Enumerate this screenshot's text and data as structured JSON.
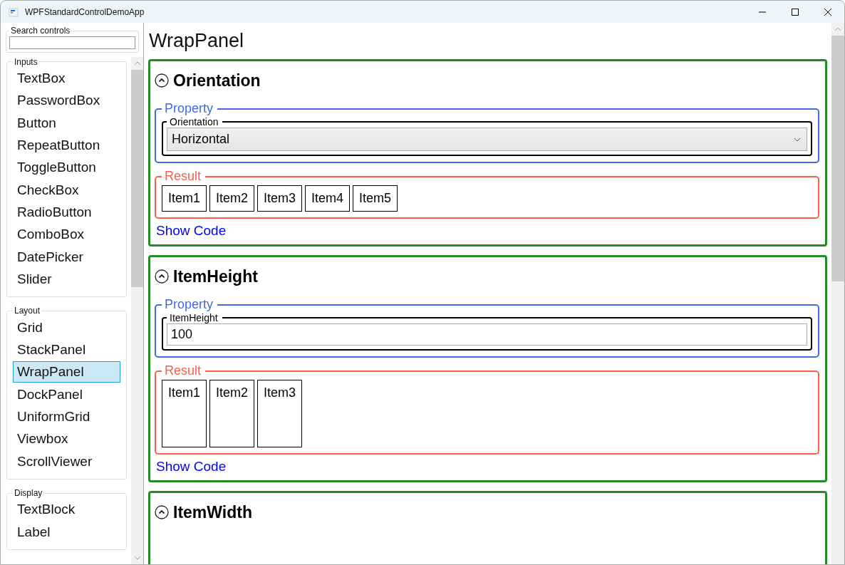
{
  "window": {
    "title": "WPFStandardControlDemoApp"
  },
  "sidebar": {
    "search": {
      "label": "Search controls"
    },
    "groups": [
      {
        "title": "Inputs",
        "items": [
          {
            "label": "TextBox",
            "selected": false
          },
          {
            "label": "PasswordBox",
            "selected": false
          },
          {
            "label": "Button",
            "selected": false
          },
          {
            "label": "RepeatButton",
            "selected": false
          },
          {
            "label": "ToggleButton",
            "selected": false
          },
          {
            "label": "CheckBox",
            "selected": false
          },
          {
            "label": "RadioButton",
            "selected": false
          },
          {
            "label": "ComboBox",
            "selected": false
          },
          {
            "label": "DatePicker",
            "selected": false
          },
          {
            "label": "Slider",
            "selected": false
          }
        ]
      },
      {
        "title": "Layout",
        "items": [
          {
            "label": "Grid",
            "selected": false
          },
          {
            "label": "StackPanel",
            "selected": false
          },
          {
            "label": "WrapPanel",
            "selected": true
          },
          {
            "label": "DockPanel",
            "selected": false
          },
          {
            "label": "UniformGrid",
            "selected": false
          },
          {
            "label": "Viewbox",
            "selected": false
          },
          {
            "label": "ScrollViewer",
            "selected": false
          }
        ]
      },
      {
        "title": "Display",
        "items": [
          {
            "label": "TextBlock",
            "selected": false
          },
          {
            "label": "Label",
            "selected": false
          }
        ]
      }
    ]
  },
  "page": {
    "title": "WrapPanel",
    "sections": [
      {
        "title": "Orientation",
        "expanded": true,
        "property": {
          "legend": "Property",
          "field": {
            "label": "Orientation",
            "kind": "combobox",
            "value": "Horizontal"
          }
        },
        "result": {
          "legend": "Result",
          "kind": "row",
          "items": [
            "Item1",
            "Item2",
            "Item3",
            "Item4",
            "Item5"
          ]
        },
        "link": "Show Code"
      },
      {
        "title": "ItemHeight",
        "expanded": true,
        "property": {
          "legend": "Property",
          "field": {
            "label": "ItemHeight",
            "kind": "textbox",
            "value": "100"
          }
        },
        "result": {
          "legend": "Result",
          "kind": "tall",
          "items": [
            "Item1",
            "Item2",
            "Item3"
          ]
        },
        "link": "Show Code"
      },
      {
        "title": "ItemWidth",
        "expanded": true
      }
    ]
  }
}
